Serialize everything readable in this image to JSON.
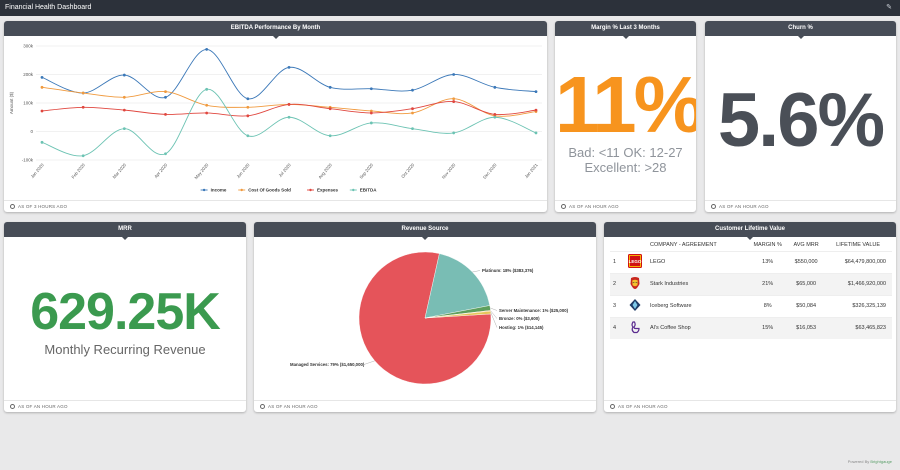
{
  "app": {
    "title": "Financial Health Dashboard",
    "edit_icon": "pencil-icon"
  },
  "tiles": {
    "ebitda": {
      "title": "EBITDA Performance By Month",
      "footer": "AS OF 3 HOURS AGO"
    },
    "margin": {
      "title": "Margin % Last 3 Months",
      "value": "11%",
      "sub_line1": "Bad: <11 OK: 12-27",
      "sub_line2": "Excellent: >28",
      "color": "#f7941e",
      "footer": "AS OF AN HOUR AGO"
    },
    "churn": {
      "title": "Churn %",
      "value": "5.6%",
      "footer": "AS OF AN HOUR AGO"
    },
    "mrr": {
      "title": "MRR",
      "value": "629.25K",
      "subtitle": "Monthly Recurring Revenue",
      "color": "#3b9a4f",
      "footer": "AS OF AN HOUR AGO"
    },
    "revenue": {
      "title": "Revenue Source",
      "footer": "AS OF AN HOUR AGO"
    },
    "clv": {
      "title": "Customer Lifetime Value",
      "columns": [
        "COMPANY - AGREEMENT",
        "MARGIN %",
        "AVG MRR",
        "LIFETIME VALUE"
      ],
      "rows": [
        {
          "n": "1",
          "company": "LEGO",
          "margin": "13%",
          "mrr": "$550,000",
          "ltv": "$64,479,800,000",
          "icon": "lego-logo-icon"
        },
        {
          "n": "2",
          "company": "Stark Industries",
          "margin": "21%",
          "mrr": "$65,000",
          "ltv": "$1,466,920,000",
          "icon": "ironman-mask-icon"
        },
        {
          "n": "3",
          "company": "Iceberg Software",
          "margin": "8%",
          "mrr": "$50,084",
          "ltv": "$326,325,139",
          "icon": "iceberg-icon"
        },
        {
          "n": "4",
          "company": "Al's Coffee Shop",
          "margin": "15%",
          "mrr": "$16,053",
          "ltv": "$63,465,823",
          "icon": "coffee-cup-icon"
        }
      ],
      "footer": "AS OF AN HOUR AGO"
    }
  },
  "powered_by": {
    "label": "Powered By",
    "brand": "Brightgauge"
  },
  "chart_data": [
    {
      "type": "line",
      "ylabel": "Amount ($)",
      "ylim": [
        -100000,
        300000
      ],
      "y_ticks": [
        "300k",
        "200k",
        "100k",
        "0",
        "-100k"
      ],
      "x": [
        "Jan 2020",
        "Feb 2020",
        "Mar 2020",
        "Apr 2020",
        "May 2020",
        "Jun 2020",
        "Jul 2020",
        "Aug 2020",
        "Sep 2020",
        "Oct 2020",
        "Nov 2020",
        "Dec 2020",
        "Jan 2021"
      ],
      "grid": true,
      "legend": "bottom",
      "series": [
        {
          "name": "Income",
          "color": "#3b78b8",
          "values": [
            190000,
            135000,
            198000,
            120000,
            288000,
            115000,
            225000,
            155000,
            150000,
            145000,
            200000,
            155000,
            140000
          ]
        },
        {
          "name": "Cost Of Goods Sold",
          "color": "#f09a3e",
          "values": [
            155000,
            135000,
            120000,
            140000,
            92000,
            85000,
            95000,
            85000,
            72000,
            65000,
            115000,
            55000,
            70000
          ]
        },
        {
          "name": "Expenses",
          "color": "#e0473f",
          "values": [
            72000,
            85000,
            75000,
            60000,
            65000,
            55000,
            95000,
            80000,
            65000,
            80000,
            105000,
            60000,
            75000
          ]
        },
        {
          "name": "EBITDA",
          "color": "#6cc3b3",
          "values": [
            -38000,
            -85000,
            10000,
            -78000,
            148000,
            -15000,
            50000,
            -15000,
            30000,
            10000,
            -5000,
            50000,
            -5000
          ]
        }
      ]
    },
    {
      "type": "pie",
      "slices": [
        {
          "label": "Managed Services: 79% ($1,650,000)",
          "value": 1650000,
          "color": "#e5545a"
        },
        {
          "label": "Platinum: 18% ($383,376)",
          "value": 383376,
          "color": "#79bdb4"
        },
        {
          "label": "Server Maintenance: 1% ($25,000)",
          "value": 25000,
          "color": "#5e9f5c"
        },
        {
          "label": "Bronze: 0% ($3,600)",
          "value": 3600,
          "color": "#f09a3e"
        },
        {
          "label": "Hosting: 1% ($14,145)",
          "value": 14145,
          "color": "#e6c65a"
        }
      ]
    }
  ]
}
